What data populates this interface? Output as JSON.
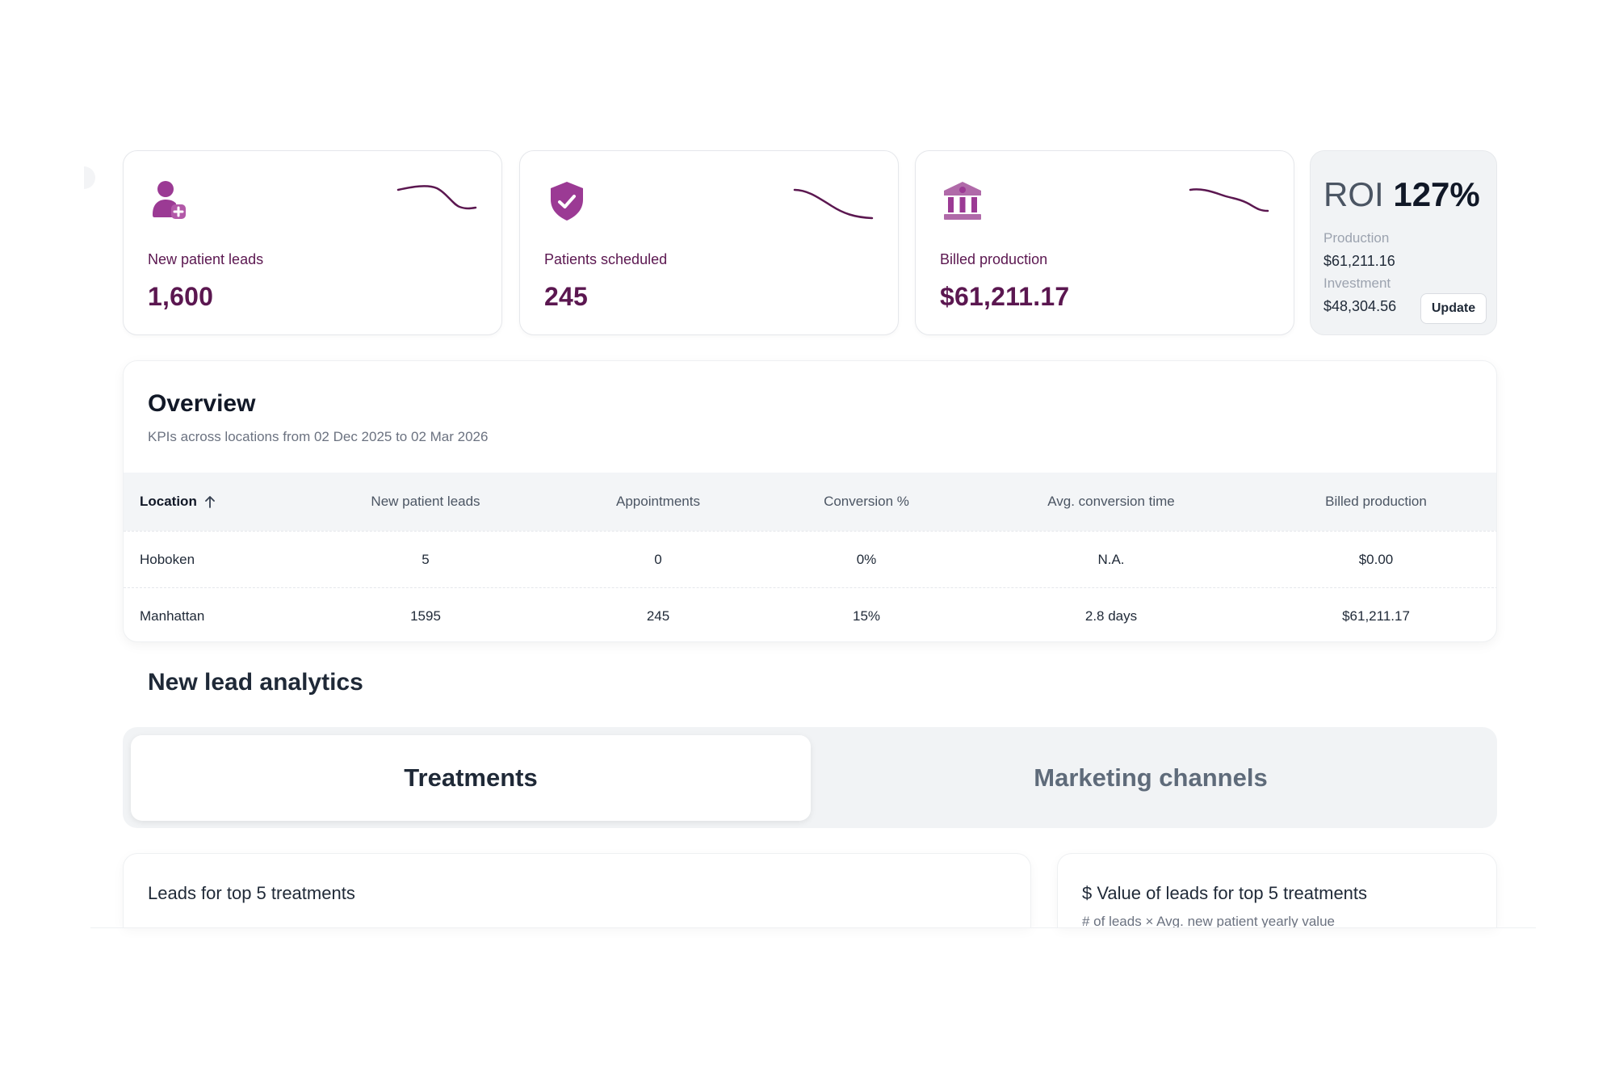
{
  "kpis": [
    {
      "label": "New patient leads",
      "value": "1,600",
      "icon": "user-plus-icon"
    },
    {
      "label": "Patients scheduled",
      "value": "245",
      "icon": "shield-check-icon"
    },
    {
      "label": "Billed production",
      "value": "$61,211.17",
      "icon": "bank-icon"
    }
  ],
  "roi": {
    "word": "ROI",
    "value": "127%",
    "production_label": "Production",
    "production_value": "$61,211.16",
    "investment_label": "Investment",
    "investment_value": "$48,304.56",
    "update_label": "Update"
  },
  "overview": {
    "title": "Overview",
    "subtitle": "KPIs across locations from 02 Dec 2025 to 02 Mar 2026",
    "columns": [
      "Location",
      "New patient leads",
      "Appointments",
      "Conversion %",
      "Avg. conversion time",
      "Billed production"
    ],
    "rows": [
      [
        "Hoboken",
        "5",
        "0",
        "0%",
        "N.A.",
        "$0.00"
      ],
      [
        "Manhattan",
        "1595",
        "245",
        "15%",
        "2.8 days",
        "$61,211.17"
      ]
    ]
  },
  "new_lead_analytics": {
    "title": "New lead analytics",
    "tabs": [
      "Treatments",
      "Marketing channels"
    ],
    "active_tab": "Treatments"
  },
  "cards": {
    "left_title": "Leads for top 5 treatments",
    "right_title": "$ Value of leads for top 5 treatments",
    "right_subtitle": "# of leads × Avg. new patient yearly value"
  },
  "colors": {
    "brand": "#5b1750",
    "icon_purple": "#9b3a94",
    "spark": "#5b1750"
  }
}
